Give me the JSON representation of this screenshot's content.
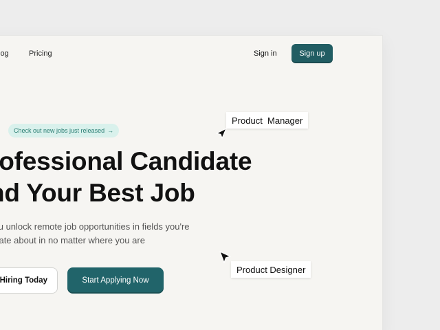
{
  "nav": {
    "links": [
      {
        "label": "log"
      },
      {
        "label": "Pricing"
      }
    ],
    "signin_label": "Sign in",
    "signup_label": "Sign up"
  },
  "hero": {
    "badge_text": "Check out new jobs just released",
    "badge_arrow": "→",
    "headline_line1": "rofessional Candidate",
    "headline_line2": "nd Your Best Job",
    "description_line1": "you unlock remote job opportunities in fields you're",
    "description_line2": "onate about in no matter where you are",
    "secondary_button_label": "Hiring Today",
    "primary_button_label": "Start Applying Now"
  },
  "floating_tags": {
    "manager": "Product  Manager",
    "designer": "Product Designer"
  },
  "colors": {
    "accent": "#215d63",
    "badge_bg": "#d9f1ec",
    "badge_text": "#287c71",
    "page_bg": "#f6f5f2",
    "outer_bg": "#ededed"
  },
  "icons": {
    "badge_arrow": "arrow-right-icon",
    "cursor": "cursor-pointer-icon"
  }
}
